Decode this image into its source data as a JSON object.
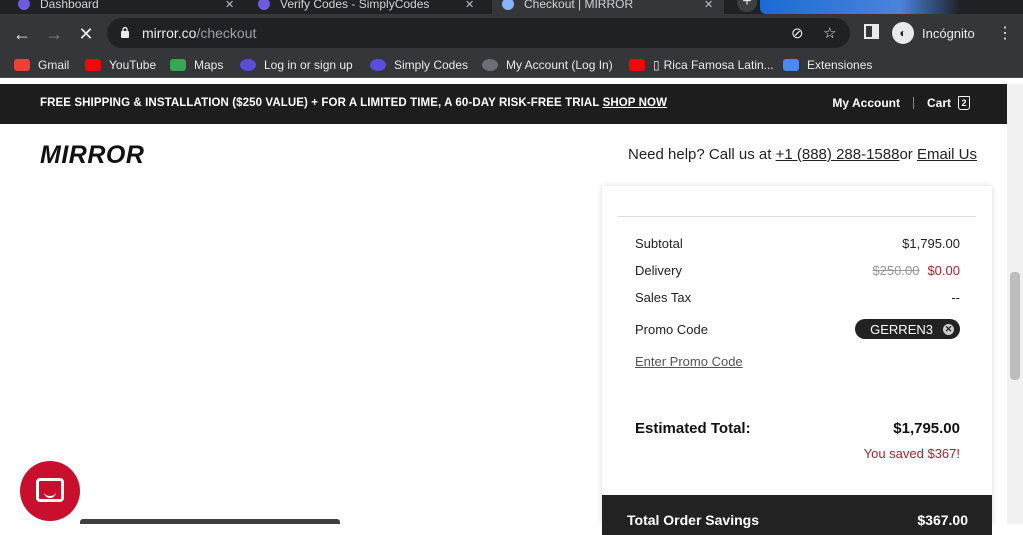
{
  "tabs": [
    {
      "label": "Dashboard"
    },
    {
      "label": "Verify Codes - SimplyCodes"
    },
    {
      "label": "Checkout | MIRROR"
    }
  ],
  "toolbar": {
    "url_host": "mirror.co",
    "url_path": "/checkout",
    "incognito_label": "Incógnito"
  },
  "bookmarks": [
    {
      "label": "Gmail",
      "icon": "gmail-icon"
    },
    {
      "label": "YouTube",
      "icon": "youtube-icon"
    },
    {
      "label": "Maps",
      "icon": "maps-icon"
    },
    {
      "label": "Log in or sign up",
      "icon": "simplycodes-icon"
    },
    {
      "label": "Simply Codes",
      "icon": "simplycodes-icon"
    },
    {
      "label": "My Account (Log In)",
      "icon": "globe-icon"
    },
    {
      "label": "Rica Famosa Latin...",
      "icon": "youtube-icon"
    },
    {
      "label": "Extensiones",
      "icon": "puzzle-icon"
    }
  ],
  "promo": {
    "text": "FREE SHIPPING & INSTALLATION ($250 VALUE) + FOR A LIMITED TIME, A 60-DAY RISK-FREE TRIAL",
    "link": "SHOP NOW",
    "account": "My Account",
    "cart": "Cart",
    "cart_count": "2"
  },
  "header": {
    "logo": "MIRROR",
    "help_prefix": "Need help? Call us at",
    "phone": "+1 (888) 288-1588",
    "help_or": "or",
    "email": "Email Us"
  },
  "summary": {
    "subtotal_label": "Subtotal",
    "subtotal_value": "$1,795.00",
    "delivery_label": "Delivery",
    "delivery_old": "$250.00",
    "delivery_value": "$0.00",
    "tax_label": "Sales Tax",
    "tax_value": "--",
    "promo_label": "Promo Code",
    "promo_code": "GERREN3",
    "enter_promo": "Enter Promo Code",
    "total_label": "Estimated Total:",
    "total_value": "$1,795.00",
    "saved": "You saved $367!",
    "savings_label": "Total Order Savings",
    "savings_value": "$367.00"
  },
  "colors": {
    "accent_red": "#a3262f",
    "chat_red": "#c8102e",
    "promo_bar": "#1d1d1d"
  }
}
